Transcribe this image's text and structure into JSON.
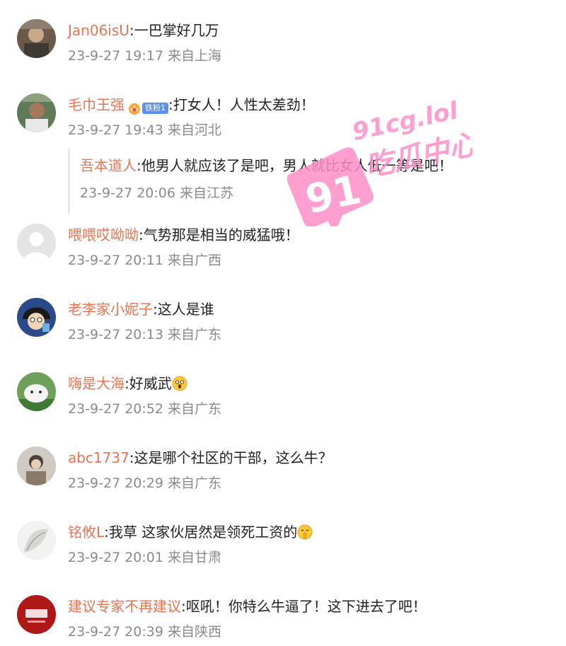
{
  "comments": [
    {
      "user": "Jan06isU",
      "text": "一巴掌好几万",
      "time": "23-9-27 19:17",
      "loc": "来自上海"
    },
    {
      "user": "毛巾王强",
      "badge": "铁粉1",
      "text": "打女人！人性太差劲！",
      "time": "23-9-27 19:43",
      "loc": "来自河北",
      "reply": {
        "user": "吾本道人",
        "text": "他男人就应该了是吧，男人就比女人低一等是吧！",
        "time": "23-9-27 20:06",
        "loc": "来自江苏"
      }
    },
    {
      "user": "喂喂哎呦呦",
      "text": "气势那是相当的威猛哦！",
      "time": "23-9-27 20:11",
      "loc": "来自广西"
    },
    {
      "user": "老李家小妮子",
      "text": "这人是谁",
      "time": "23-9-27 20:13",
      "loc": "来自广东"
    },
    {
      "user": "嗨是大海",
      "text": "好威武",
      "emoji": "shocked-face",
      "time": "23-9-27 20:52",
      "loc": "来自广东"
    },
    {
      "user": "abc1737",
      "text": "这是哪个社区的干部，这么牛？",
      "time": "23-9-27 20:29",
      "loc": "来自广东"
    },
    {
      "user": "铭攸L",
      "text": "我草 这家伙居然是领死工资的",
      "emoji": "shushing-face",
      "time": "23-9-27 20:01",
      "loc": "来自甘肃"
    },
    {
      "user": "建议专家不再建议",
      "text": "呕吼！你特么牛逼了！这下进去了吧！",
      "time": "23-9-27 20:39",
      "loc": "来自陕西"
    }
  ],
  "watermark": {
    "site": "91cg.lol",
    "name": "吃瓜中心",
    "logo": "91",
    "color": "#ff8fc7"
  },
  "colors": {
    "username": "#eb7350",
    "meta": "#8a8a8a",
    "text": "#222222",
    "badge": "#5b8ff0"
  }
}
